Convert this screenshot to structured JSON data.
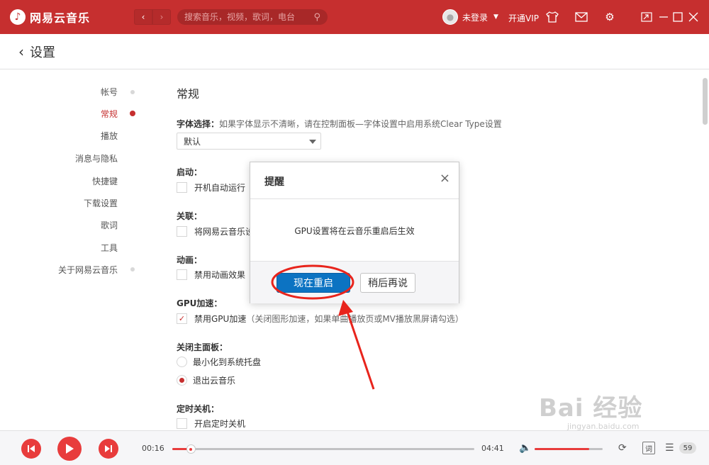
{
  "app": {
    "name": "网易云音乐",
    "search_placeholder": "搜索音乐，视频，歌词，电台",
    "user_name": "未登录",
    "vip_label": "开通VIP"
  },
  "header": {
    "title": "设置"
  },
  "sidebar": {
    "items": [
      {
        "label": "帐号",
        "active": false
      },
      {
        "label": "常规",
        "active": true
      },
      {
        "label": "播放",
        "active": false
      },
      {
        "label": "消息与隐私",
        "active": false
      },
      {
        "label": "快捷键",
        "active": false
      },
      {
        "label": "下载设置",
        "active": false
      },
      {
        "label": "歌词",
        "active": false
      },
      {
        "label": "工具",
        "active": false
      },
      {
        "label": "关于网易云音乐",
        "active": false
      }
    ]
  },
  "content": {
    "section_title": "常规",
    "font": {
      "label": "字体选择：",
      "desc": "如果字体显示不清晰，请在控制面板—字体设置中启用系统Clear Type设置",
      "value": "默认"
    },
    "startup": {
      "label": "启动：",
      "option": "开机自动运行",
      "checked": false
    },
    "assoc": {
      "label": "关联：",
      "option": "将网易云音乐设",
      "checked": false
    },
    "animation": {
      "label": "动画：",
      "option": "禁用动画效果",
      "checked": false
    },
    "gpu": {
      "label": "GPU加速：",
      "option": "禁用GPU加速",
      "hint": "（关闭图形加速，如果单曲播放页或MV播放黑屏请勾选）",
      "checked": true
    },
    "close_panel": {
      "label": "关闭主面板：",
      "options": [
        {
          "label": "最小化到系统托盘",
          "selected": false
        },
        {
          "label": "退出云音乐",
          "selected": true
        }
      ]
    },
    "timer": {
      "label": "定时关机：",
      "option": "开启定时关机",
      "checked": false
    }
  },
  "dialog": {
    "title": "提醒",
    "message": "GPU设置将在云音乐重启后生效",
    "primary_label": "现在重启",
    "secondary_label": "稍后再说"
  },
  "player": {
    "current_time": "00:16",
    "total_time": "04:41",
    "progress": 0.06,
    "volume": 0.8,
    "lyric_label": "词",
    "playlist_count": "59"
  },
  "watermark": {
    "main": "Bai 经验",
    "sub": "jingyan.baidu.com"
  },
  "colors": {
    "brand": "#c62f2f",
    "primary_button": "#0c73c2",
    "annotation": "#e8241c"
  }
}
